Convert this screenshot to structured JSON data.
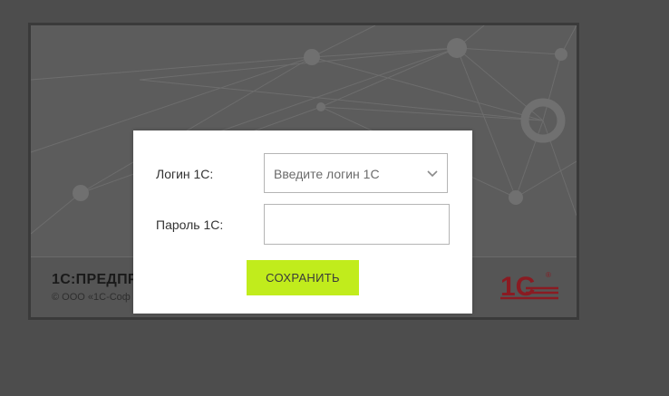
{
  "splash": {
    "product_title": "1С:ПРЕДПР",
    "copyright": "© ООО «1С-Соф",
    "logo_text": "1С",
    "logo_mark": "®"
  },
  "dialog": {
    "login_label": "Логин 1С:",
    "login_placeholder": "Введите логин 1С",
    "password_label": "Пароль 1С:",
    "password_value": "",
    "save_label": "СОХРАНИТЬ"
  },
  "icons": {
    "dropdown": "chevron-down-icon",
    "logo": "1c-logo-icon"
  },
  "colors": {
    "overlay": "#4d4d4d",
    "accent_button": "#c1ec1c",
    "logo_red": "#c8102e"
  }
}
